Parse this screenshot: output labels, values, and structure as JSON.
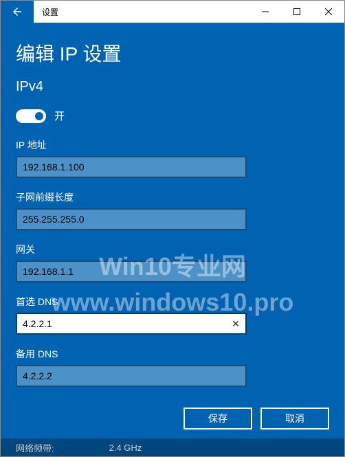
{
  "window": {
    "title": "设置"
  },
  "page": {
    "title": "编辑 IP 设置",
    "subtitle": "IPv4"
  },
  "toggle": {
    "label": "开",
    "state": true
  },
  "fields": {
    "ip": {
      "label": "IP 地址",
      "value": "192.168.1.100"
    },
    "subnet": {
      "label": "子网前缀长度",
      "value": "255.255.255.0"
    },
    "gateway": {
      "label": "网关",
      "value": "192.168.1.1"
    },
    "dns1": {
      "label": "首选 DNS",
      "value": "4.2.2.1"
    },
    "dns2": {
      "label": "备用 DNS",
      "value": "4.2.2.2"
    }
  },
  "actions": {
    "save": "保存",
    "cancel": "取消"
  },
  "statusbar": {
    "label": "网络频带:",
    "value": "2.4 GHz"
  },
  "watermark": {
    "line1": "Win10专业网",
    "line2": "www.windows10.pro"
  },
  "icons": {
    "clear": "✕"
  }
}
